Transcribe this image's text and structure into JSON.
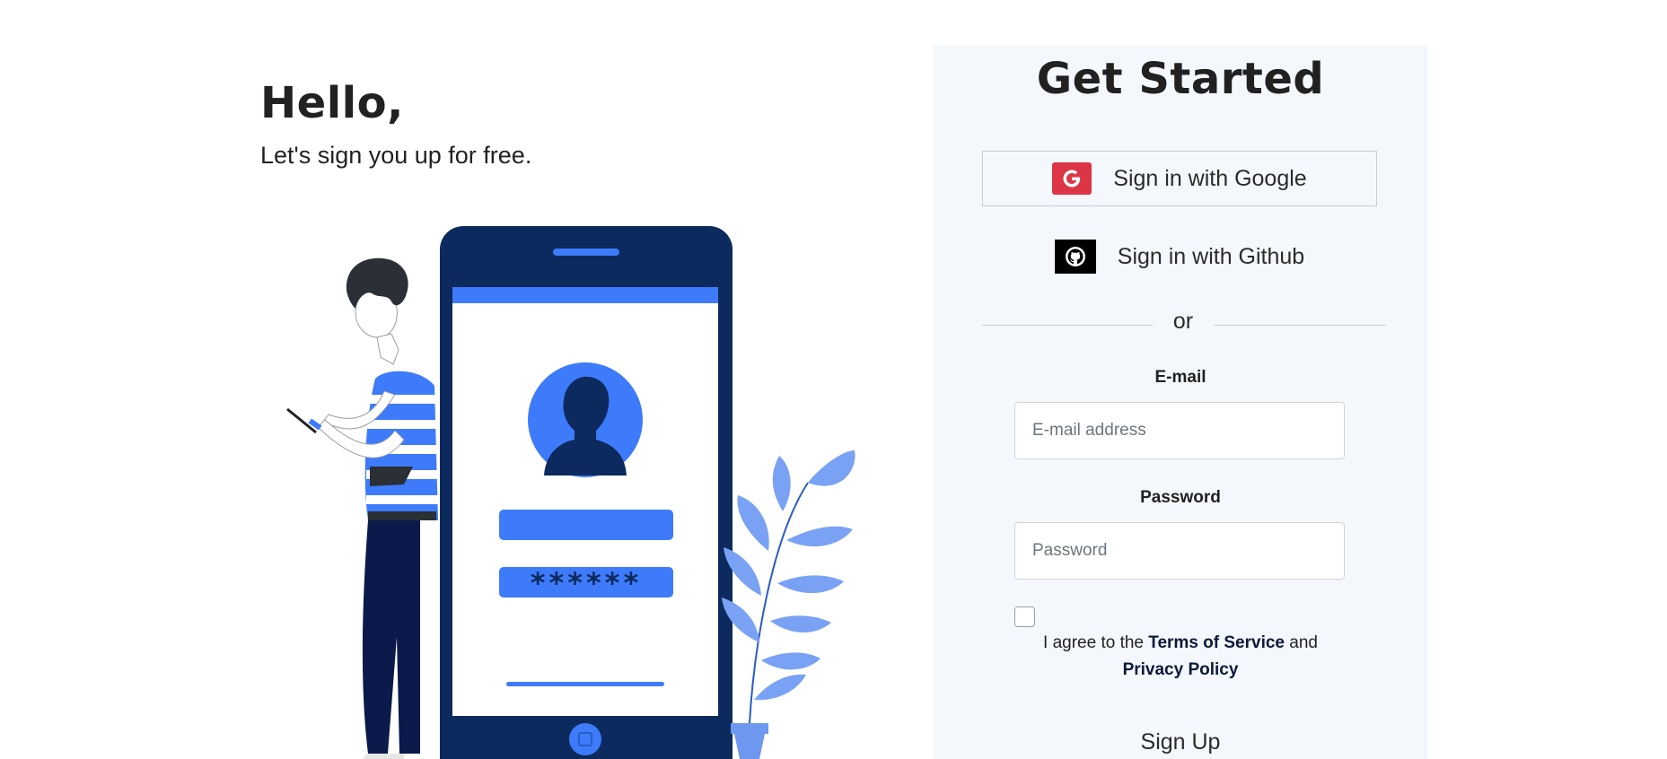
{
  "intro": {
    "heading": "Hello,",
    "subtitle": "Let's sign you up for free."
  },
  "illustration": {
    "password_mask": "******"
  },
  "panel": {
    "title": "Get Started",
    "google_label": "Sign in with Google",
    "github_label": "Sign in with Github",
    "divider_text": "or",
    "email": {
      "label": "E-mail",
      "placeholder": "E-mail address",
      "value": ""
    },
    "password": {
      "label": "Password",
      "placeholder": "Password",
      "value": ""
    },
    "terms": {
      "checked": false,
      "prefix": "I agree to the",
      "tos_link": "Terms of Service",
      "conjunction": "and",
      "privacy_link": "Privacy Policy"
    },
    "signup_label": "Sign Up"
  },
  "colors": {
    "accent": "#3d7bfa",
    "navy": "#0c2a5e",
    "google_red": "#dc3545",
    "panel_bg": "#f4f8fd"
  },
  "icons": {
    "google": "google-icon",
    "github": "github-icon"
  }
}
